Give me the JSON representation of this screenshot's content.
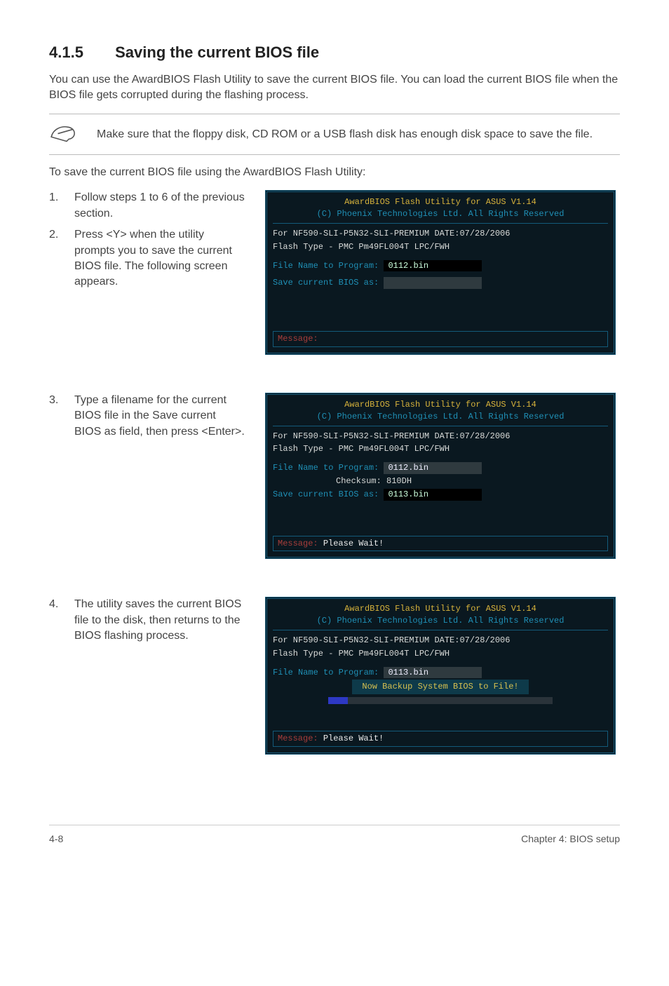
{
  "heading": {
    "number": "4.1.5",
    "title": "Saving the current BIOS file"
  },
  "intro": "You can use the AwardBIOS Flash Utility to save the current BIOS file. You can load the current BIOS file when the BIOS file gets corrupted during the flashing process.",
  "note": "Make sure that the floppy disk, CD ROM or a USB flash disk has enough disk space to save the file.",
  "lead": "To save the current BIOS file using the AwardBIOS Flash Utility:",
  "steps": {
    "s1": {
      "num": "1.",
      "text": "Follow steps 1 to 6 of the previous section."
    },
    "s2": {
      "num": "2.",
      "text": "Press <Y> when the utility prompts you to save the current BIOS file. The following screen appears."
    },
    "s3": {
      "num": "3.",
      "text": "Type a filename for the current BIOS file in the Save current BIOS as field, then press <Enter>."
    },
    "s4": {
      "num": "4.",
      "text": "The utility saves the current BIOS file to the disk, then returns to the BIOS flashing process."
    }
  },
  "bios": {
    "title": "AwardBIOS Flash Utility for ASUS V1.14",
    "copyright": "(C) Phoenix Technologies Ltd. All Rights Reserved",
    "for_line": "For NF590-SLI-P5N32-SLI-PREMIUM    DATE:07/28/2006",
    "flash_type": "Flash Type - PMC Pm49FL004T LPC/FWH",
    "file_program_label": "File Name to Program:",
    "save_label": "Save current BIOS as:",
    "checksum_label": "Checksum:",
    "checksum_value": "810DH",
    "msg_label": "Message:",
    "please_wait": "Please Wait!",
    "backup": "Now Backup System BIOS to File!",
    "file1": "0112.bin",
    "file2": "0113.bin"
  },
  "footer": {
    "left": "4-8",
    "right": "Chapter 4: BIOS setup"
  }
}
